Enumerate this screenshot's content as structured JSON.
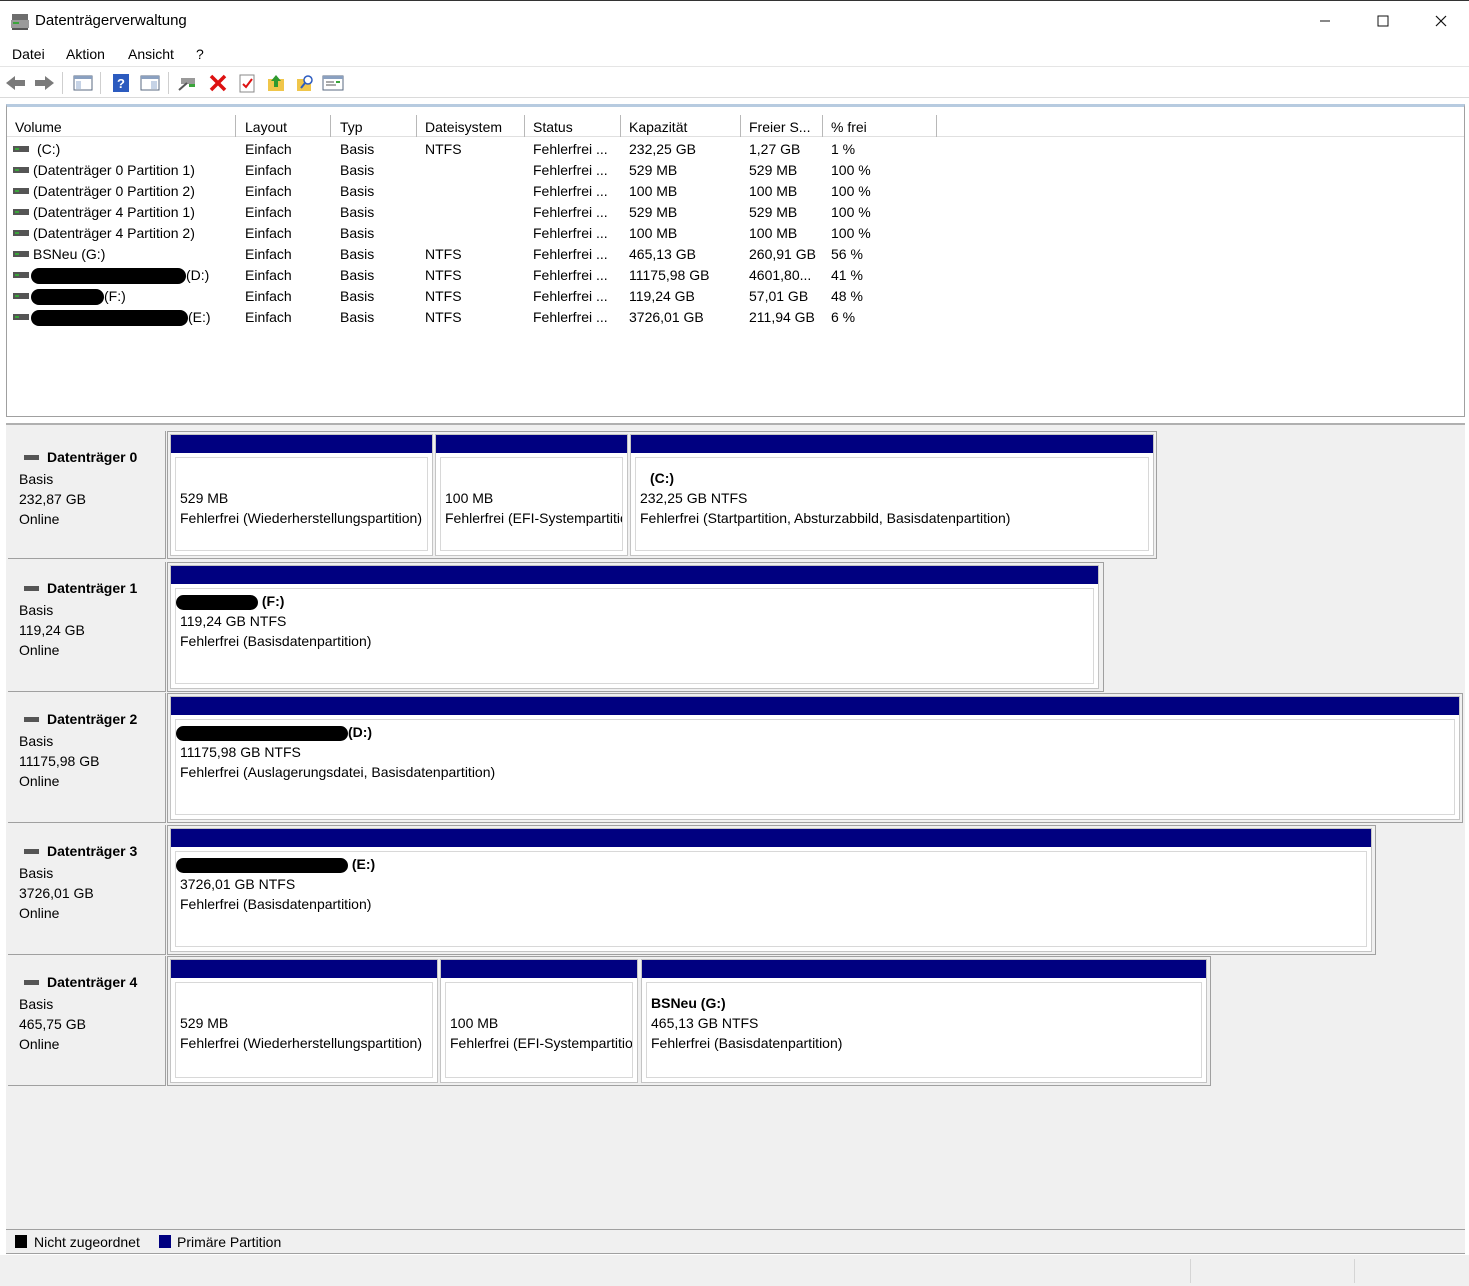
{
  "window": {
    "title": "Datenträgerverwaltung",
    "minimize": "—",
    "maximize": "☐",
    "close": "✕"
  },
  "menu": {
    "items": [
      "Datei",
      "Aktion",
      "Ansicht",
      "?"
    ]
  },
  "toolbar": {
    "icons": [
      "back-arrow-icon",
      "forward-arrow-icon",
      "console-tree-icon",
      "help-icon",
      "properties-icon",
      "connect-icon",
      "delete-icon",
      "check-icon",
      "up-folder-icon",
      "search-icon",
      "settings-icon"
    ]
  },
  "volume_list": {
    "columns": [
      "Volume",
      "Layout",
      "Typ",
      "Dateisystem",
      "Status",
      "Kapazität",
      "Freier S...",
      "% frei"
    ],
    "rows": [
      {
        "volume": "(C:)",
        "layout": "Einfach",
        "typ": "Basis",
        "fs": "NTFS",
        "status": "Fehlerfrei ...",
        "cap": "232,25 GB",
        "free": "1,27 GB",
        "pct": "1 %"
      },
      {
        "volume": "(Datenträger 0 Partition 1)",
        "layout": "Einfach",
        "typ": "Basis",
        "fs": "",
        "status": "Fehlerfrei ...",
        "cap": "529 MB",
        "free": "529 MB",
        "pct": "100 %"
      },
      {
        "volume": "(Datenträger 0 Partition 2)",
        "layout": "Einfach",
        "typ": "Basis",
        "fs": "",
        "status": "Fehlerfrei ...",
        "cap": "100 MB",
        "free": "100 MB",
        "pct": "100 %"
      },
      {
        "volume": "(Datenträger 4 Partition 1)",
        "layout": "Einfach",
        "typ": "Basis",
        "fs": "",
        "status": "Fehlerfrei ...",
        "cap": "529 MB",
        "free": "529 MB",
        "pct": "100 %"
      },
      {
        "volume": "(Datenträger 4 Partition 2)",
        "layout": "Einfach",
        "typ": "Basis",
        "fs": "",
        "status": "Fehlerfrei ...",
        "cap": "100 MB",
        "free": "100 MB",
        "pct": "100 %"
      },
      {
        "volume": "BSNeu (G:)",
        "layout": "Einfach",
        "typ": "Basis",
        "fs": "NTFS",
        "status": "Fehlerfrei ...",
        "cap": "465,13 GB",
        "free": "260,91 GB",
        "pct": "56 %"
      },
      {
        "volume": "(D:)",
        "layout": "Einfach",
        "typ": "Basis",
        "fs": "NTFS",
        "status": "Fehlerfrei ...",
        "cap": "11175,98 GB",
        "free": "4601,80...",
        "pct": "41 %"
      },
      {
        "volume": "(F:)",
        "layout": "Einfach",
        "typ": "Basis",
        "fs": "NTFS",
        "status": "Fehlerfrei ...",
        "cap": "119,24 GB",
        "free": "57,01 GB",
        "pct": "48 %"
      },
      {
        "volume": "(E:)",
        "layout": "Einfach",
        "typ": "Basis",
        "fs": "NTFS",
        "status": "Fehlerfrei ...",
        "cap": "3726,01 GB",
        "free": "211,94 GB",
        "pct": "6 %"
      }
    ]
  },
  "disks": [
    {
      "name": "Datenträger 0",
      "type": "Basis",
      "size": "232,87 GB",
      "state": "Online",
      "partitions": [
        {
          "label": "",
          "size": "529 MB",
          "status": "Fehlerfrei (Wiederherstellungspartition)"
        },
        {
          "label": "",
          "size": "100 MB",
          "status": "Fehlerfrei (EFI-Systempartition)"
        },
        {
          "label": "(C:)",
          "size": "232,25 GB NTFS",
          "status": "Fehlerfrei (Startpartition, Absturzabbild, Basisdatenpartition)"
        }
      ]
    },
    {
      "name": "Datenträger 1",
      "type": "Basis",
      "size": "119,24 GB",
      "state": "Online",
      "partitions": [
        {
          "label": "(F:)",
          "size": "119,24 GB NTFS",
          "status": "Fehlerfrei (Basisdatenpartition)"
        }
      ]
    },
    {
      "name": "Datenträger 2",
      "type": "Basis",
      "size": "11175,98 GB",
      "state": "Online",
      "partitions": [
        {
          "label": "(D:)",
          "size": "11175,98 GB NTFS",
          "status": "Fehlerfrei (Auslagerungsdatei, Basisdatenpartition)"
        }
      ]
    },
    {
      "name": "Datenträger 3",
      "type": "Basis",
      "size": "3726,01 GB",
      "state": "Online",
      "partitions": [
        {
          "label": "(E:)",
          "size": "3726,01 GB NTFS",
          "status": "Fehlerfrei (Basisdatenpartition)"
        }
      ]
    },
    {
      "name": "Datenträger 4",
      "type": "Basis",
      "size": "465,75 GB",
      "state": "Online",
      "partitions": [
        {
          "label": "",
          "size": "529 MB",
          "status": "Fehlerfrei (Wiederherstellungspartition)"
        },
        {
          "label": "",
          "size": "100 MB",
          "status": "Fehlerfrei (EFI-Systempartition)"
        },
        {
          "label": "BSNeu  (G:)",
          "size": "465,13 GB NTFS",
          "status": "Fehlerfrei (Basisdatenpartition)"
        }
      ]
    }
  ],
  "legend": [
    {
      "label": "Nicht zugeordnet",
      "color": "#000000"
    },
    {
      "label": "Primäre Partition",
      "color": "#000080"
    }
  ],
  "colors": {
    "primary_partition": "#000080",
    "unallocated": "#000000"
  }
}
